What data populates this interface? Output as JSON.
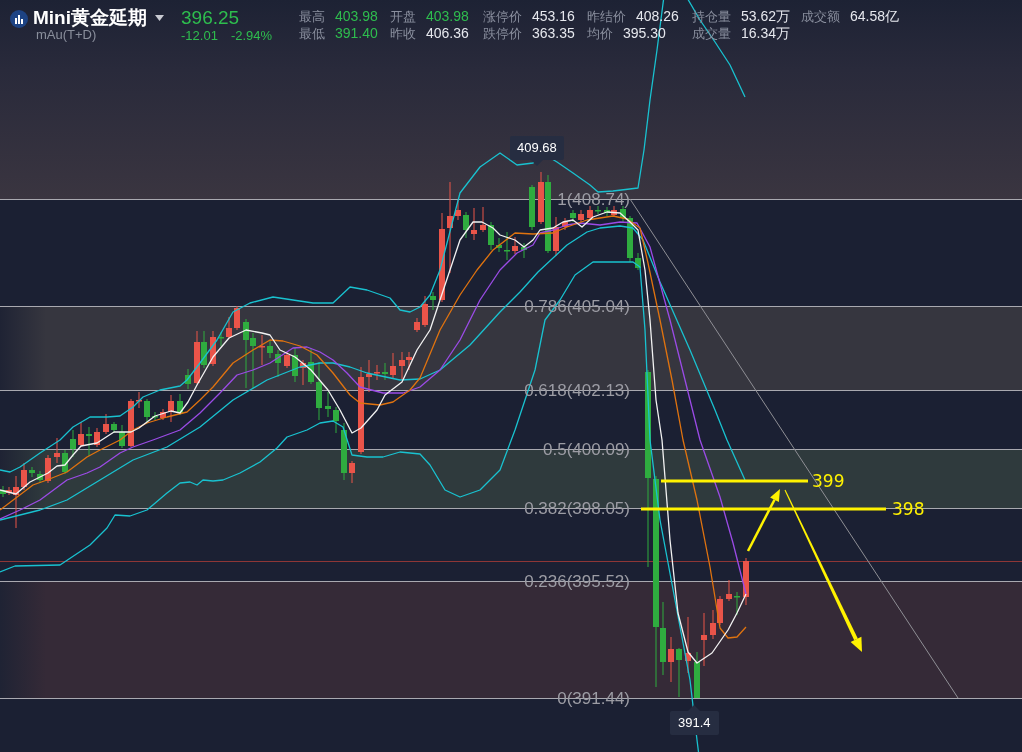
{
  "header": {
    "instrument": {
      "name": "Mini黄金延期",
      "code": "mAu(T+D)"
    },
    "quote": {
      "price": "396.25",
      "change": "-12.01",
      "change_pct": "-2.94%",
      "falling": true
    },
    "stats": [
      [
        {
          "label": "最高",
          "value": "403.98",
          "falling": true
        },
        {
          "label": "开盘",
          "value": "403.98",
          "falling": true
        },
        {
          "label": "涨停价",
          "value": "453.16",
          "falling": false
        },
        {
          "label": "昨结价",
          "value": "408.26",
          "falling": false
        },
        {
          "label": "持仓量",
          "value": "53.62万",
          "falling": false
        },
        {
          "label": "成交额",
          "value": "64.58亿",
          "falling": false
        }
      ],
      [
        {
          "label": "最低",
          "value": "391.40",
          "falling": true
        },
        {
          "label": "昨收",
          "value": "406.36",
          "falling": false
        },
        {
          "label": "跌停价",
          "value": "363.35",
          "falling": false
        },
        {
          "label": "均价",
          "value": "395.30",
          "falling": false
        },
        {
          "label": "成交量",
          "value": "16.34万",
          "falling": false
        }
      ]
    ]
  },
  "chart": {
    "fib_levels": [
      {
        "label": "1(408.74)"
      },
      {
        "label": "0.786(405.04)"
      },
      {
        "label": "0.618(402.13)"
      },
      {
        "label": "0.5(400.09)"
      },
      {
        "label": "0.382(398.05)"
      },
      {
        "label": "0.236(395.52)"
      },
      {
        "label": "0(391.44)"
      }
    ],
    "high_tag": "409.68",
    "low_tag": "391.4",
    "targets": [
      {
        "label": "399"
      },
      {
        "label": "398"
      }
    ]
  }
}
